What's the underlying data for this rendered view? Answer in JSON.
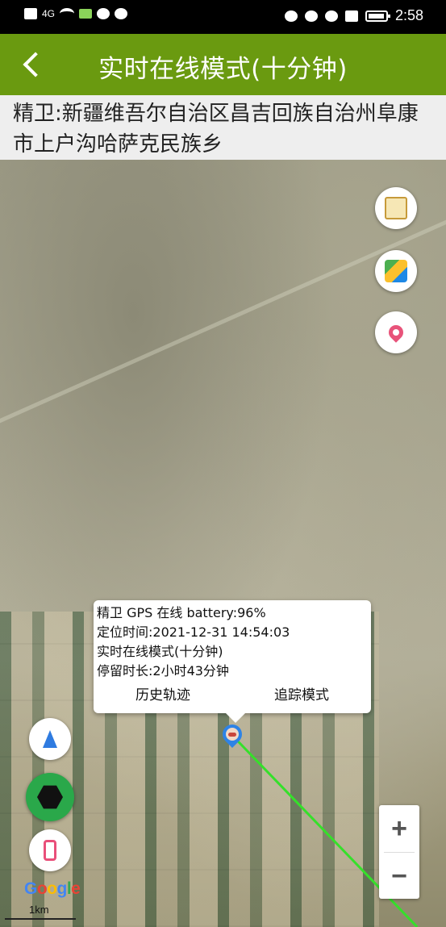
{
  "status_bar": {
    "network": "4G",
    "time": "2:58"
  },
  "header": {
    "title": "实时在线模式(十分钟)"
  },
  "address": {
    "text": "精卫:新疆维吾尔自治区昌吉回族自治州阜康市上户沟哈萨克民族乡"
  },
  "info_window": {
    "line1": "精卫 GPS 在线 battery:96%",
    "line2": "定位时间:2021-12-31 14:54:03",
    "line3": "实时在线模式(十分钟)",
    "line4": "停留时长:2小时43分钟",
    "history_label": "历史轨迹",
    "tracking_label": "追踪模式"
  },
  "map": {
    "zoom_in_label": "+",
    "zoom_out_label": "−",
    "logo_text": "Google",
    "scale_label": "1km",
    "track_color": "#35e02a"
  },
  "icons": {
    "right_fabs": [
      "label-toggle-icon",
      "map-layers-icon",
      "location-pin-icon"
    ],
    "left_fabs": [
      "navigation-icon",
      "hexagon-satellite-icon",
      "phone-icon"
    ]
  }
}
